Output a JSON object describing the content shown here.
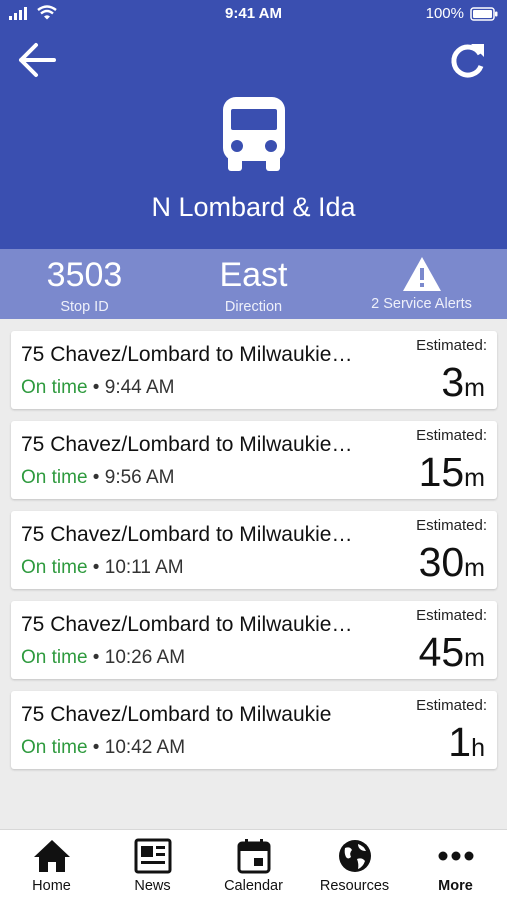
{
  "status_bar": {
    "time": "9:41 AM",
    "battery": "100%"
  },
  "header": {
    "stop_name": "N Lombard & Ida",
    "back_icon": "arrow-left-icon",
    "refresh_icon": "refresh-icon",
    "bus_icon": "bus-icon"
  },
  "info": {
    "stop_id": {
      "value": "3503",
      "label": "Stop ID"
    },
    "direction": {
      "value": "East",
      "label": "Direction"
    },
    "alerts": {
      "icon": "warning-icon",
      "label": "2 Service Alerts"
    }
  },
  "arrivals": [
    {
      "route": "75 Chavez/Lombard to Milwaukie…",
      "status": "On time",
      "sep": " • ",
      "time": "9:44 AM",
      "est_label": "Estimated:",
      "est_value": "3",
      "est_unit": "m"
    },
    {
      "route": "75 Chavez/Lombard to Milwaukie…",
      "status": "On time",
      "sep": " • ",
      "time": "9:56 AM",
      "est_label": "Estimated:",
      "est_value": "15",
      "est_unit": "m"
    },
    {
      "route": "75 Chavez/Lombard to Milwaukie…",
      "status": "On time",
      "sep": " • ",
      "time": "10:11 AM",
      "est_label": "Estimated:",
      "est_value": "30",
      "est_unit": "m"
    },
    {
      "route": "75 Chavez/Lombard to Milwaukie…",
      "status": "On time",
      "sep": " • ",
      "time": "10:26 AM",
      "est_label": "Estimated:",
      "est_value": "45",
      "est_unit": "m"
    },
    {
      "route": "75 Chavez/Lombard to Milwaukie",
      "status": "On time",
      "sep": " • ",
      "time": "10:42 AM",
      "est_label": "Estimated:",
      "est_value": "1",
      "est_unit": "h"
    }
  ],
  "tabs": [
    {
      "label": "Home",
      "icon": "home-icon"
    },
    {
      "label": "News",
      "icon": "news-icon"
    },
    {
      "label": "Calendar",
      "icon": "calendar-icon"
    },
    {
      "label": "Resources",
      "icon": "globe-icon"
    },
    {
      "label": "More",
      "icon": "more-icon",
      "active": true
    }
  ],
  "colors": {
    "header_bg": "#3a4fb0",
    "info_bg": "#7b89cd",
    "on_time": "#2e9a3e"
  }
}
